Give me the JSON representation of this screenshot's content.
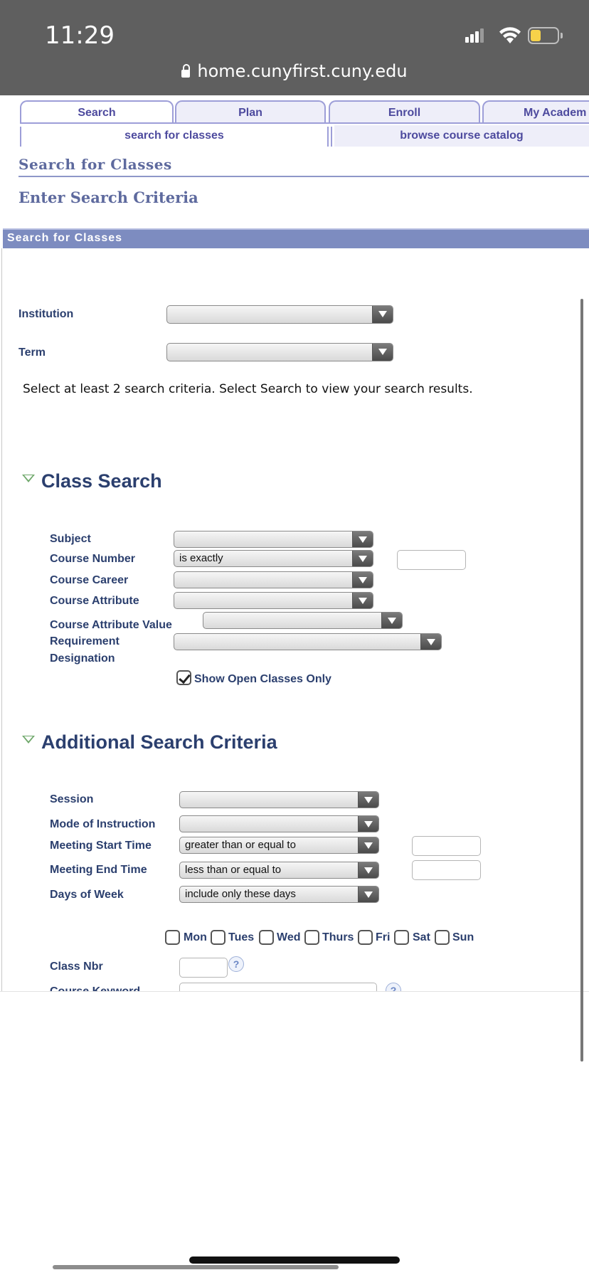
{
  "status_bar": {
    "time": "11:29",
    "url": "home.cunyfirst.cuny.edu"
  },
  "tabs": [
    {
      "label": "Search",
      "active": true
    },
    {
      "label": "Plan",
      "active": false
    },
    {
      "label": "Enroll",
      "active": false
    },
    {
      "label": "My Academ",
      "active": false
    }
  ],
  "subtabs": [
    {
      "label": "search for classes"
    },
    {
      "label": "browse course catalog"
    }
  ],
  "page": {
    "title": "Search for Classes",
    "subtitle": "Enter Search Criteria",
    "panel_title": "Search for Classes",
    "instruction": "Select at least 2 search criteria. Select Search to view your search results."
  },
  "top_fields": {
    "institution_label": "Institution",
    "institution_value": "",
    "term_label": "Term",
    "term_value": ""
  },
  "class_search": {
    "heading": "Class Search",
    "subject_label": "Subject",
    "subject_value": "",
    "course_number_label": "Course Number",
    "course_number_operator": "is exactly",
    "course_number_value": "",
    "course_career_label": "Course Career",
    "course_career_value": "",
    "course_attribute_label": "Course Attribute",
    "course_attribute_value": "",
    "course_attribute_value_label": "Course Attribute Value",
    "course_attribute_value_value": "",
    "requirement_label_1": "Requirement",
    "requirement_label_2": "Designation",
    "requirement_value": "",
    "show_open_label": "Show Open Classes Only",
    "show_open_checked": true
  },
  "additional": {
    "heading": "Additional Search Criteria",
    "session_label": "Session",
    "session_value": "",
    "mode_label": "Mode of Instruction",
    "mode_value": "",
    "start_label": "Meeting Start Time",
    "start_operator": "greater than or equal to",
    "start_value": "",
    "end_label": "Meeting End Time",
    "end_operator": "less than or equal to",
    "end_value": "",
    "days_label": "Days of Week",
    "days_operator": "include only these days",
    "days": [
      "Mon",
      "Tues",
      "Wed",
      "Thurs",
      "Fri",
      "Sat",
      "Sun"
    ],
    "class_nbr_label": "Class Nbr",
    "class_nbr_value": "",
    "course_keyword_label": "Course Keyword",
    "help_glyph": "?"
  }
}
